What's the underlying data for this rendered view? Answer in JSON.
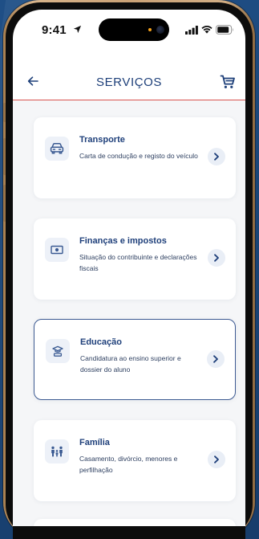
{
  "status_bar": {
    "time": "9:41"
  },
  "header": {
    "title": "SERVIÇOS",
    "back_icon": "arrow-left-icon",
    "cart_icon": "shopping-cart-icon"
  },
  "colors": {
    "accent": "#1e3f7a",
    "divider": "#d9534f",
    "selected_border": "#3d5a92",
    "card_icon_bg": "#edf1f8",
    "background": "#f5f6f8"
  },
  "services": [
    {
      "icon": "car-icon",
      "title": "Transporte",
      "description": "Carta de condução e registo do veículo",
      "selected": false
    },
    {
      "icon": "banknote-icon",
      "title": "Finanças e impostos",
      "description": "Situação do contribuinte e declarações fiscais",
      "selected": false
    },
    {
      "icon": "graduation-icon",
      "title": "Educação",
      "description": "Candidatura ao ensino superior e dossier do aluno",
      "selected": true
    },
    {
      "icon": "family-icon",
      "title": "Família",
      "description": "Casamento, divórcio, menores e perfilhação",
      "selected": false
    }
  ]
}
